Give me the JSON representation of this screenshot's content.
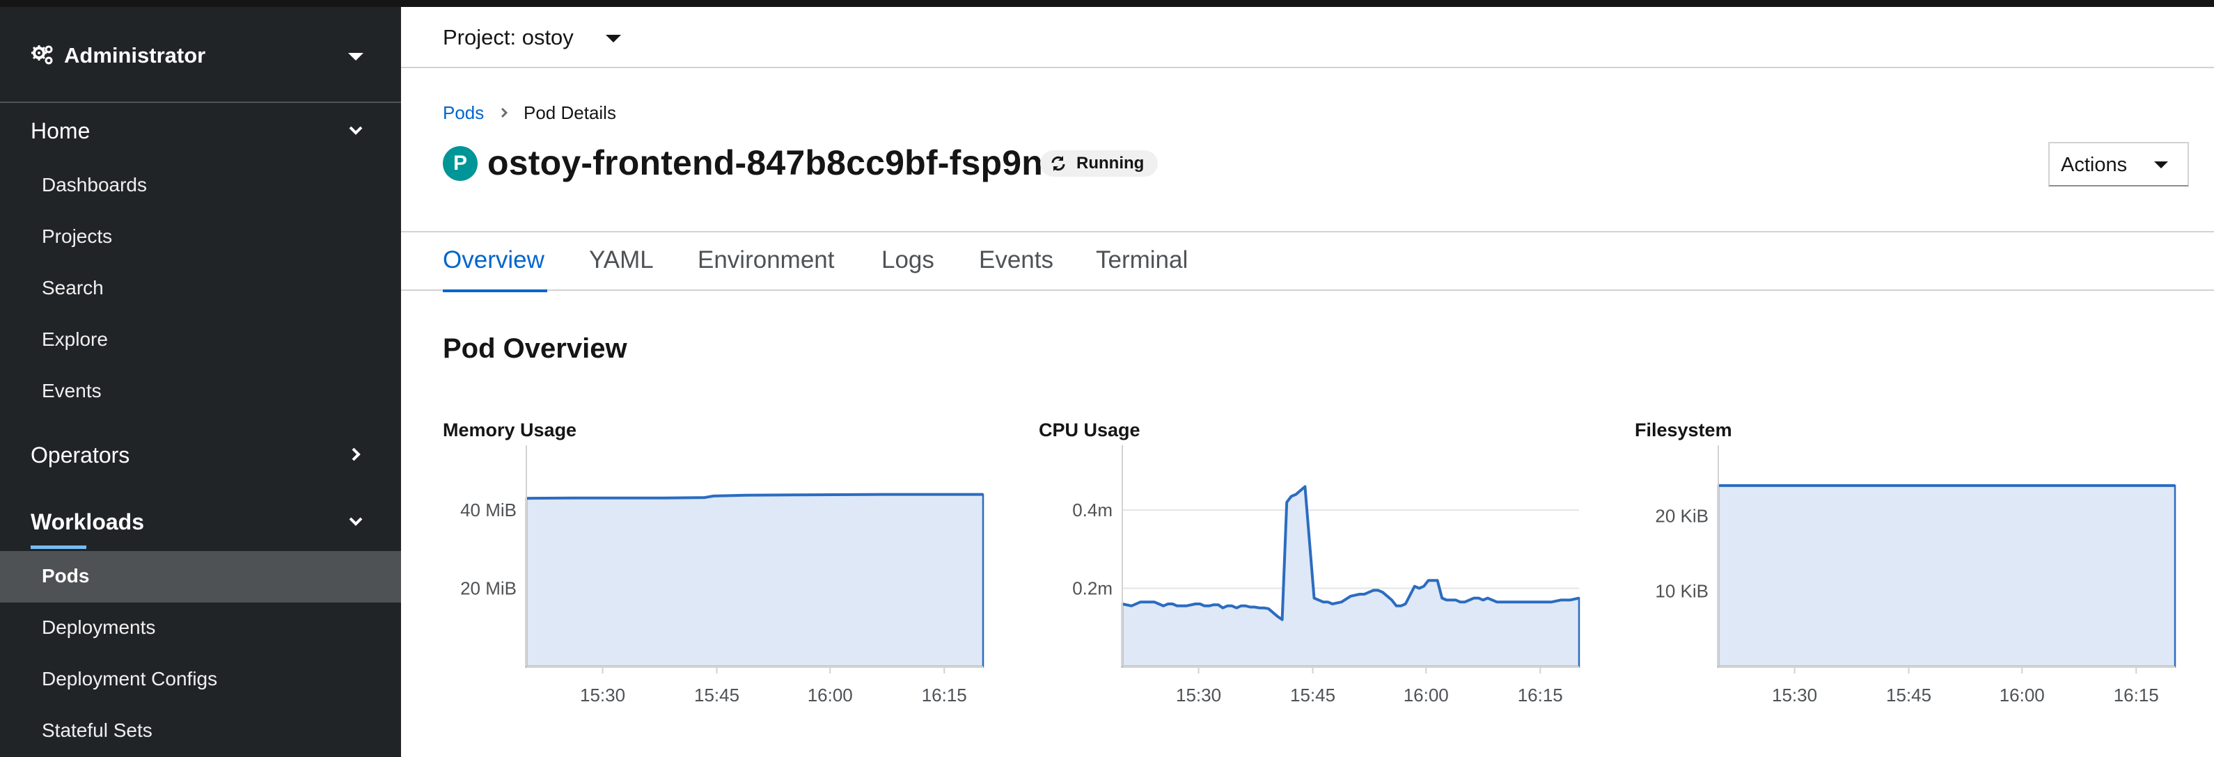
{
  "sidebar": {
    "perspective": "Administrator",
    "sections": [
      {
        "label": "Home",
        "items": [
          "Dashboards",
          "Projects",
          "Search",
          "Explore",
          "Events"
        ]
      },
      {
        "label": "Operators"
      },
      {
        "label": "Workloads",
        "items": [
          "Pods",
          "Deployments",
          "Deployment Configs",
          "Stateful Sets"
        ]
      }
    ]
  },
  "header": {
    "project_label": "Project: ostoy"
  },
  "breadcrumb": {
    "link": "Pods",
    "current": "Pod Details"
  },
  "pod": {
    "badge": "P",
    "name": "ostoy-frontend-847b8cc9bf-fsp9n",
    "status": "Running"
  },
  "actions_label": "Actions",
  "tabs": [
    "Overview",
    "YAML",
    "Environment",
    "Logs",
    "Events",
    "Terminal"
  ],
  "section_title": "Pod Overview",
  "colors": {
    "accent": "#0066cc",
    "sidebar_bg": "#212427",
    "chart_line": "#2b6cc0",
    "chart_fill": "#dfe8f6"
  },
  "chart_data": [
    {
      "type": "area",
      "title": "Memory Usage",
      "x_ticks": [
        "15:30",
        "15:45",
        "16:00",
        "16:15"
      ],
      "y_ticks": [
        {
          "label": "20 MiB",
          "value": 20
        },
        {
          "label": "40 MiB",
          "value": 40
        }
      ],
      "ylim": [
        0,
        53
      ],
      "x": [
        0,
        10,
        20,
        30,
        39,
        41,
        48,
        60,
        80,
        100
      ],
      "values": [
        43.0,
        43.1,
        43.1,
        43.1,
        43.2,
        43.6,
        43.8,
        43.9,
        44.0,
        44.0
      ]
    },
    {
      "type": "area",
      "title": "CPU Usage",
      "x_ticks": [
        "15:30",
        "15:45",
        "16:00",
        "16:15"
      ],
      "y_ticks": [
        {
          "label": "0.2m",
          "value": 0.2
        },
        {
          "label": "0.4m",
          "value": 0.4
        }
      ],
      "ylim": [
        0,
        0.53
      ],
      "x": [
        0,
        2,
        4,
        6,
        7,
        8,
        9,
        10,
        11,
        12,
        14,
        16,
        17,
        18,
        19,
        20,
        21,
        22,
        23,
        24,
        25,
        26,
        27,
        28,
        29,
        30,
        31,
        32,
        34,
        35,
        36,
        37,
        38,
        40,
        42,
        44,
        45,
        46,
        48,
        50,
        52,
        53,
        54,
        55,
        56,
        57,
        58,
        59,
        60,
        61,
        62,
        64,
        65,
        66,
        67,
        68,
        69,
        70,
        71,
        72,
        73,
        74,
        75,
        76,
        77,
        78,
        79,
        80,
        82,
        84,
        85,
        86,
        88,
        90,
        92,
        94,
        96,
        98,
        100
      ],
      "values": [
        0.16,
        0.155,
        0.165,
        0.165,
        0.165,
        0.16,
        0.155,
        0.16,
        0.16,
        0.155,
        0.155,
        0.16,
        0.16,
        0.155,
        0.155,
        0.158,
        0.158,
        0.15,
        0.155,
        0.155,
        0.15,
        0.155,
        0.155,
        0.152,
        0.152,
        0.15,
        0.15,
        0.148,
        0.128,
        0.12,
        0.42,
        0.435,
        0.44,
        0.46,
        0.175,
        0.165,
        0.165,
        0.16,
        0.165,
        0.18,
        0.185,
        0.185,
        0.19,
        0.195,
        0.195,
        0.19,
        0.18,
        0.17,
        0.155,
        0.155,
        0.16,
        0.205,
        0.2,
        0.205,
        0.22,
        0.22,
        0.22,
        0.175,
        0.17,
        0.17,
        0.17,
        0.165,
        0.165,
        0.17,
        0.175,
        0.175,
        0.17,
        0.175,
        0.165,
        0.165,
        0.165,
        0.165,
        0.165,
        0.165,
        0.165,
        0.165,
        0.17,
        0.17,
        0.175
      ]
    },
    {
      "type": "area",
      "title": "Filesystem",
      "x_ticks": [
        "15:30",
        "15:45",
        "16:00",
        "16:15"
      ],
      "y_ticks": [
        {
          "label": "10 KiB",
          "value": 10
        },
        {
          "label": "20 KiB",
          "value": 20
        }
      ],
      "ylim": [
        0,
        27.5
      ],
      "x": [
        0,
        100
      ],
      "values": [
        24,
        24
      ]
    }
  ]
}
